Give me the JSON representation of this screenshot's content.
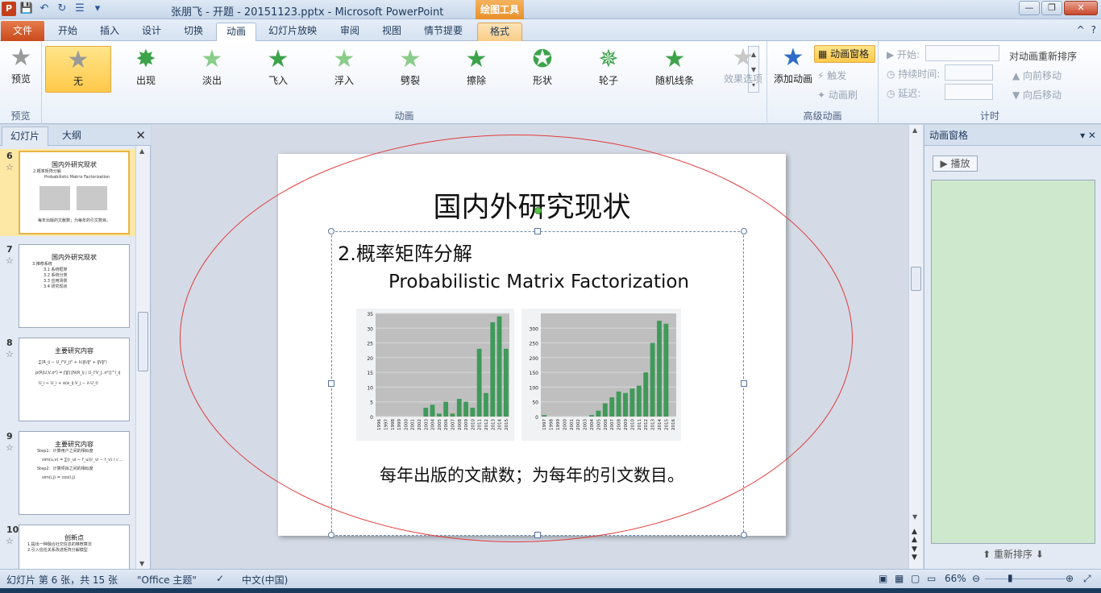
{
  "window": {
    "title": "张朋飞 - 开题 - 20151123.pptx  -  Microsoft PowerPoint",
    "contextual_tab_group": "绘图工具",
    "controls": {
      "minimize": "—",
      "maximize": "❐",
      "close": "✕"
    },
    "qat": {
      "app": "P",
      "save": "💾",
      "undo": "↶",
      "redo": "↻",
      "list": "☰",
      "customize": "▾"
    }
  },
  "tabs": {
    "file": "文件",
    "items": [
      "开始",
      "插入",
      "设计",
      "切换",
      "动画",
      "幻灯片放映",
      "审阅",
      "视图",
      "情节提要",
      "格式"
    ],
    "active": "动画",
    "right": {
      "minimize_ribbon": "^",
      "help": "?"
    }
  },
  "ribbon": {
    "preview": {
      "label": "预览",
      "group": "预览"
    },
    "animation_group": "动画",
    "gallery": [
      "无",
      "出现",
      "淡出",
      "飞入",
      "浮入",
      "劈裂",
      "擦除",
      "形状",
      "轮子",
      "随机线条"
    ],
    "gallery_selected": "无",
    "effect_options": "效果选项",
    "advanced": {
      "group": "高级动画",
      "add_animation": "添加动画",
      "animation_pane": "动画窗格",
      "trigger": "触发",
      "painter": "动画刷"
    },
    "timing": {
      "group": "计时",
      "start": "开始:",
      "duration": "持续时间:",
      "delay": "延迟:",
      "reorder_title": "对动画重新排序",
      "move_earlier": "向前移动",
      "move_later": "向后移动"
    }
  },
  "left_panel": {
    "tabs": [
      "幻灯片",
      "大纲"
    ],
    "close": "✕",
    "slides": [
      {
        "num": "6",
        "title": "国内外研究现状",
        "lines": [
          "2.概率矩阵分解",
          "Probabilistic Matrix Factorization"
        ],
        "footer": "每年出版的文献数；为每年的引文数目。",
        "selected": true
      },
      {
        "num": "7",
        "title": "国内外研究现状",
        "lines": [
          "3.推荐系统",
          "3.1 系统框架",
          "3.2 系统分类",
          "3.3 应用场景",
          "3.4 研究现状"
        ],
        "selected": false
      },
      {
        "num": "8",
        "title": "主要研究内容",
        "lines": [
          "∑(R_ij − U_iᵀV_j)² + λ(‖U‖² + ‖V‖²)",
          "p(R|U,V,σ²) = ∏∏ [N(R_ij | U_iᵀV_j, σ²)]^I_ij",
          "U_i ← U_i + α(e_ij·V_j − λ·U_i)"
        ],
        "selected": false
      },
      {
        "num": "9",
        "title": "主要研究内容",
        "lines": [
          "Step1：计算用户之间的相似度",
          "sim(u,v) = ∑(r_ui − r̄_u)(r_vi − r̄_v) / √…",
          "Step2：计算项目之间的相似度",
          "sim(i,j) = cos(i,j)"
        ],
        "selected": false
      },
      {
        "num": "10",
        "title": "创新点",
        "lines": [
          "1.提出一种融合社交信息的推荐算法",
          "2.引入信任关系改进矩阵分解模型"
        ],
        "selected": false
      }
    ]
  },
  "slide": {
    "title": "国内外研究现状",
    "subhead": "2.概率矩阵分解",
    "eng_title": "Probabilistic Matrix Factorization",
    "caption": "每年出版的文献数；为每年的引文数目。"
  },
  "chart_data": [
    {
      "type": "bar",
      "title": "",
      "categories": [
        "1996",
        "1997",
        "1998",
        "1999",
        "2000",
        "2001",
        "2002",
        "2003",
        "2004",
        "2005",
        "2006",
        "2007",
        "2008",
        "2009",
        "2010",
        "2011",
        "2012",
        "2013",
        "2014",
        "2015"
      ],
      "values": [
        0,
        0,
        0,
        0,
        0,
        0,
        0,
        3,
        4,
        1,
        5,
        1,
        6,
        5,
        3,
        23,
        8,
        32,
        34,
        23
      ],
      "ylim": [
        0,
        35
      ],
      "yticks": [
        0,
        5,
        10,
        15,
        20,
        25,
        30,
        35
      ],
      "color": "#3f9a5a",
      "background": "#bfbfbf",
      "grid": true
    },
    {
      "type": "bar",
      "title": "",
      "categories": [
        "1997",
        "1998",
        "1999",
        "2000",
        "2001",
        "2002",
        "2003",
        "2004",
        "2005",
        "2006",
        "2007",
        "2008",
        "2009",
        "2010",
        "2011",
        "2012",
        "2013",
        "2014",
        "2015",
        "2016"
      ],
      "values": [
        5,
        0,
        0,
        0,
        0,
        0,
        0,
        5,
        20,
        45,
        65,
        85,
        80,
        95,
        105,
        150,
        250,
        325,
        315,
        0
      ],
      "ylim": [
        0,
        350
      ],
      "yticks": [
        0,
        50,
        100,
        150,
        200,
        250,
        300
      ],
      "color": "#3f9a5a",
      "background": "#bfbfbf",
      "grid": true
    }
  ],
  "anim_pane": {
    "title": "动画窗格",
    "controls": "▾ ✕",
    "play": "▶ 播放",
    "reorder_label": "重新排序"
  },
  "statusbar": {
    "slide_info": "幻灯片 第 6 张，共 15 张",
    "theme": "\"Office 主题\"",
    "language": "中文(中国)",
    "zoom": "66%"
  },
  "colors": {
    "accent_file": "#c84a1a",
    "selection": "#ffc94a",
    "ellipse": "#e23a3a",
    "bar": "#3f9a5a"
  }
}
